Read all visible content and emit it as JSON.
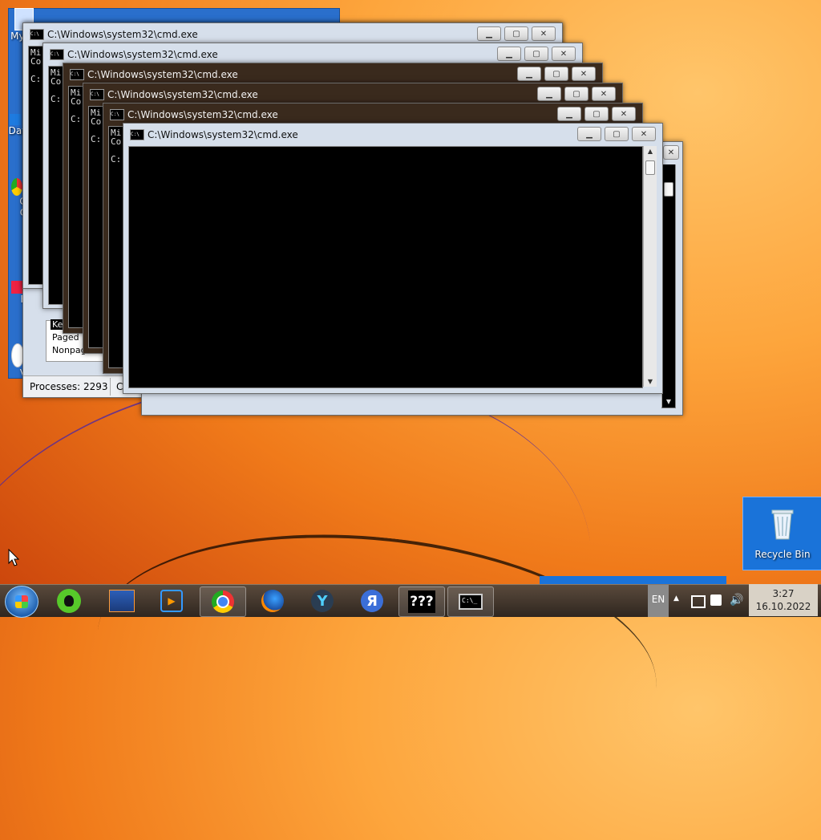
{
  "windows": {
    "cmd_title": "C:\\Windows\\system32\\cmd.exe",
    "peek_prefix_1": "Mi",
    "peek_prefix_2": "Co",
    "peek_prompt": "C:"
  },
  "taskmgr": {
    "status_processes": "Processes: 2293",
    "status_second_char": "C",
    "group_label": "Ke",
    "row1": "Paged",
    "row2": "Nonpag"
  },
  "desktop": {
    "icon_partial_1": "My C",
    "icon_partial_2": "Data",
    "icon_partial_3": "G",
    "icon_partial_4": "C",
    "icon_partial_5": "F",
    "icon_partial_6": "V",
    "recycle_bin_label": "Recycle Bin"
  },
  "taskbar": {
    "language": "EN",
    "time": "3:27",
    "date": "16.10.2022",
    "question_app_label": "???"
  },
  "colors": {
    "accent_blue": "#1a73d9",
    "taskbar_dark": "#2f261f"
  }
}
